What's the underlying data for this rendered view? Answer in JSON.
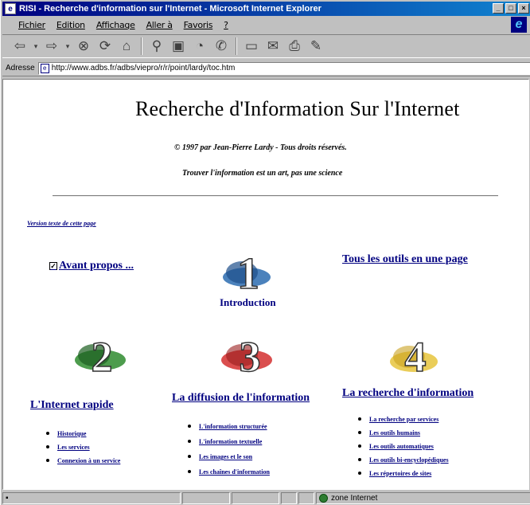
{
  "window": {
    "title": "RISI - Recherche d'information sur l'Internet - Microsoft Internet Explorer",
    "buttons": [
      "_",
      "□",
      "×"
    ]
  },
  "menu": [
    "Fichier",
    "Edition",
    "Affichage",
    "Aller à",
    "Favoris",
    "?"
  ],
  "address": {
    "label": "Adresse",
    "url": "http://www.adbs.fr/adbs/viepro/r/r/point/lardy/toc.htm"
  },
  "page": {
    "title": "Recherche d'Information Sur l'Internet",
    "copyright": "© 1997 par Jean-Pierre Lardy - Tous droits réservés.",
    "motto": "Trouver l'information est un art, pas une science",
    "text_version_link": "Version texte de cette page",
    "avant_propos": "Avant propos ...",
    "tous_outils": "Tous les outils en une page",
    "section1": {
      "number": "1",
      "color": "#2b6cb0",
      "label": "Introduction"
    },
    "section2": {
      "number": "2",
      "color": "#2e8b2e",
      "label": "L'Internet rapide",
      "items": [
        "Historique",
        "Les services",
        "Connexion à un service"
      ]
    },
    "section3": {
      "number": "3",
      "color": "#d32f2f",
      "label": "La diffusion de l'information",
      "items": [
        "L'information structurée",
        "L'information textuelle",
        "Les images et le son",
        "Les chaînes d'information"
      ]
    },
    "section4": {
      "number": "4",
      "color": "#e6c43c",
      "label": "La recherche d'information",
      "items": [
        "La recherche par services",
        "Les outils humains",
        "Les outils automatiques",
        "Les outils bi-encyclopédiques",
        "Les répertoires de sites"
      ]
    }
  },
  "status": {
    "zone": "zone Internet"
  }
}
